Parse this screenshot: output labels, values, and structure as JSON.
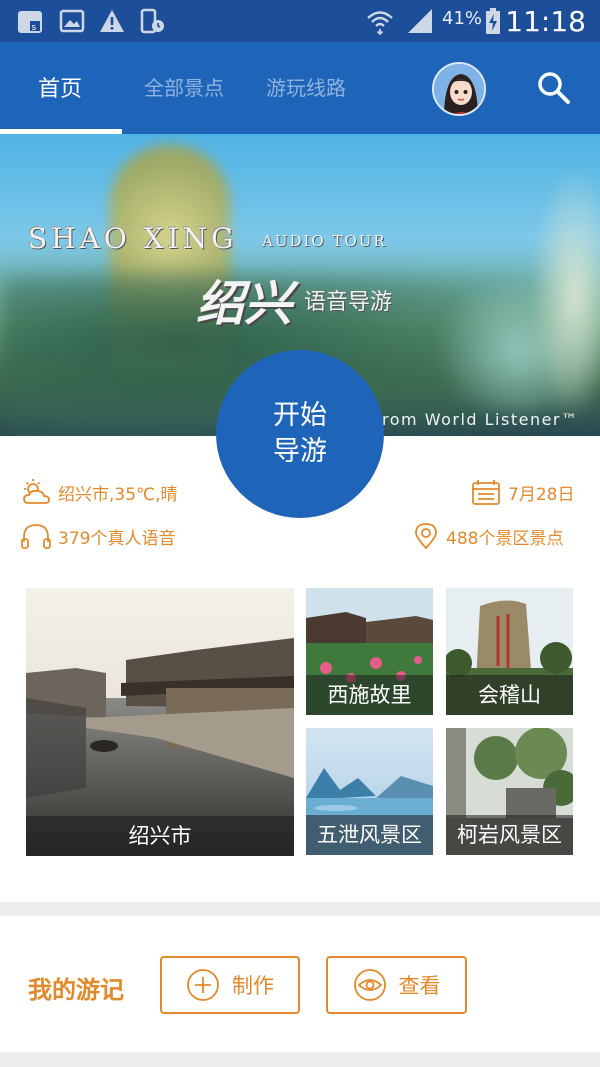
{
  "status_bar": {
    "battery": "41%",
    "time": "11:18"
  },
  "header": {
    "tabs": [
      {
        "label": "首页",
        "active": true
      },
      {
        "label": "全部景点",
        "active": false
      },
      {
        "label": "游玩线路",
        "active": false
      }
    ],
    "accent_color": "#1e64b8"
  },
  "hero": {
    "title_en": "SHAO XING",
    "title_sub": "AUDIO TOUR",
    "title_cn": "绍兴",
    "title_cn2": "语音导游",
    "credit": "rom World Listener™"
  },
  "start_button": {
    "line1": "开始",
    "line2": "导游"
  },
  "info": {
    "weather": "绍兴市,35℃,晴",
    "date": "7月28日",
    "audio_count": "379个真人语音",
    "spots_count": "488个景区景点",
    "text_color": "#e28a2b"
  },
  "tiles": [
    {
      "label": "绍兴市"
    },
    {
      "label": "西施故里"
    },
    {
      "label": "会稽山"
    },
    {
      "label": "五泄风景区"
    },
    {
      "label": "柯岩风景区"
    }
  ],
  "journal": {
    "title": "我的游记",
    "create_label": "制作",
    "view_label": "查看"
  }
}
